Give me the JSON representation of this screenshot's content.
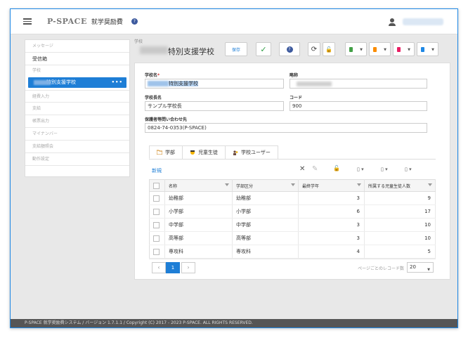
{
  "header": {
    "logo": "P-SPACE",
    "app_name": "就学奨励費",
    "help_mark": "?"
  },
  "sidebar": {
    "items": [
      {
        "label": "メッセージ"
      },
      {
        "label": "受信箱"
      },
      {
        "label": "学校"
      },
      {
        "label": "特別支援学校"
      },
      {
        "label": "経費入力"
      },
      {
        "label": "支給"
      },
      {
        "label": "帳票出力"
      },
      {
        "label": "マイナンバー"
      },
      {
        "label": "支給額照会"
      },
      {
        "label": "動作設定"
      }
    ],
    "active_more": "•••"
  },
  "page": {
    "breadcrumb": "学校",
    "title": "特別支援学校",
    "save_label": "保存",
    "check_mark": "✓",
    "help_mark": "?",
    "refresh_glyph": "⟳",
    "unlock_glyph": "🔓",
    "doc_colors": [
      "#43a047",
      "#fb8c00",
      "#e91e63",
      "#1e88e5"
    ]
  },
  "form": {
    "school_name_label": "学校名",
    "required_mark": "*",
    "school_name_value": "特別支援学校",
    "abbr_label": "略称",
    "principal_label": "学校長名",
    "principal_value": "サンプル学校長",
    "code_label": "コード",
    "code_value": "900",
    "contact_label": "保護者等問い合わせ先",
    "contact_value": "0824-74-0353(P-SPACE)"
  },
  "tabs": [
    {
      "label": "学部",
      "icon": "folder-icon"
    },
    {
      "label": "児童生徒",
      "icon": "student-icon"
    },
    {
      "label": "学校ユーザー",
      "icon": "users-icon"
    }
  ],
  "grid_toolbar": {
    "new_label": "新規",
    "delete_glyph": "✕",
    "edit_glyph": "✎",
    "unlock_glyph": "🔓"
  },
  "table": {
    "columns": [
      "名称",
      "学部区分",
      "最終学年",
      "所属する児童生徒人数"
    ],
    "rows": [
      [
        "幼稚部",
        "幼稚部",
        "3",
        "9"
      ],
      [
        "小学部",
        "小学部",
        "6",
        "17"
      ],
      [
        "中学部",
        "中学部",
        "3",
        "10"
      ],
      [
        "高等部",
        "高等部",
        "3",
        "10"
      ],
      [
        "専攻科",
        "専攻科",
        "4",
        "5"
      ]
    ]
  },
  "pager": {
    "prev": "‹",
    "current": "1",
    "next": "›",
    "rpp_label": "ページごとのレコード数",
    "rpp_value": "20"
  },
  "footer": {
    "text": "P-SPACE 就学奨励費システム / バージョン 1.7.1.1 / Copyright (C) 2017 - 2023 P-SPACE. ALL RIGHTS RESERVED."
  }
}
